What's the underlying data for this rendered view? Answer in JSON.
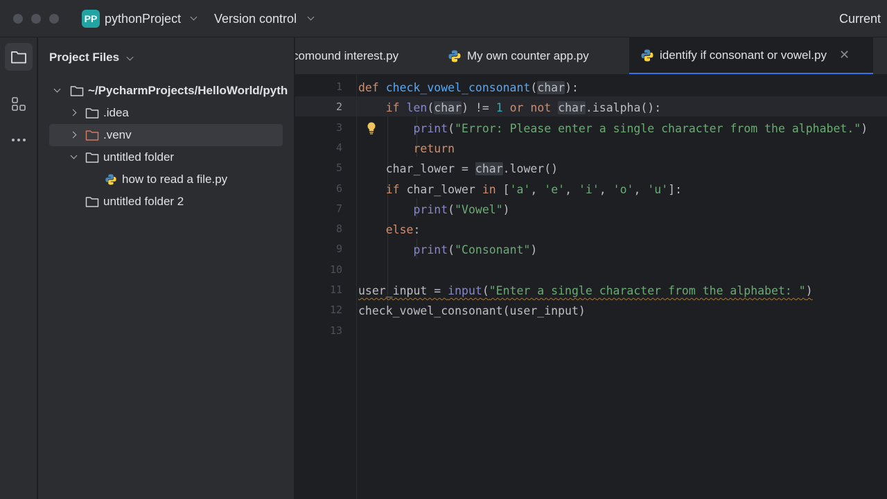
{
  "titlebar": {
    "project_badge": "PP",
    "project_name": "pythonProject",
    "vcs_label": "Version control",
    "run_config": "Current"
  },
  "toolstrip": {
    "icons": [
      "folder-icon",
      "structure-icon",
      "more-icon"
    ]
  },
  "project_panel": {
    "title": "Project Files",
    "tree": [
      {
        "label": "~/PycharmProjects/HelloWorld/pyth",
        "type": "folder",
        "expanded": true,
        "depth": 0
      },
      {
        "label": ".idea",
        "type": "folder",
        "expanded": false,
        "depth": 1
      },
      {
        "label": ".venv",
        "type": "folder-excluded",
        "expanded": false,
        "depth": 1,
        "selected": true
      },
      {
        "label": "untitled folder",
        "type": "folder",
        "expanded": true,
        "depth": 1
      },
      {
        "label": "how to read a file.py",
        "type": "python-file",
        "depth": 2
      },
      {
        "label": "untitled folder 2",
        "type": "folder",
        "depth": 1
      }
    ]
  },
  "tabs": [
    {
      "label": "comound interest.py",
      "active": false
    },
    {
      "label": "My own counter app.py",
      "active": false
    },
    {
      "label": "identify if consonant or vowel.py",
      "active": true
    }
  ],
  "editor": {
    "current_line": 2,
    "line_numbers": [
      "1",
      "2",
      "3",
      "4",
      "5",
      "6",
      "7",
      "8",
      "9",
      "10",
      "11",
      "12",
      "13"
    ],
    "lines": [
      {
        "indent": "",
        "tokens": [
          [
            "kw",
            "def "
          ],
          [
            "fn",
            "check_vowel_consonant"
          ],
          [
            "",
            "("
          ],
          [
            "hl",
            "char"
          ],
          [
            "",
            "):"
          ]
        ]
      },
      {
        "indent": "    ",
        "tokens": [
          [
            "kw",
            "if "
          ],
          [
            "bi",
            "len"
          ],
          [
            "",
            "("
          ],
          [
            "hl",
            "char"
          ],
          [
            "",
            ") != "
          ],
          [
            "num",
            "1"
          ],
          [
            "kw",
            " or not "
          ],
          [
            "hl",
            "char"
          ],
          [
            "",
            ".isalpha():"
          ]
        ]
      },
      {
        "indent": "        ",
        "tokens": [
          [
            "bi",
            "print"
          ],
          [
            "",
            "("
          ],
          [
            "str",
            "\"Error: Please enter a single character from the alphabet.\""
          ],
          [
            "",
            ")"
          ]
        ]
      },
      {
        "indent": "        ",
        "tokens": [
          [
            "kw",
            "return"
          ]
        ]
      },
      {
        "indent": "    ",
        "tokens": [
          [
            "",
            "char_lower = "
          ],
          [
            "hl",
            "char"
          ],
          [
            "",
            ".lower()"
          ]
        ]
      },
      {
        "indent": "    ",
        "tokens": [
          [
            "kw",
            "if "
          ],
          [
            "",
            "char_lower "
          ],
          [
            "kw",
            "in "
          ],
          [
            "",
            "["
          ],
          [
            "str",
            "'a'"
          ],
          [
            "",
            ", "
          ],
          [
            "str",
            "'e'"
          ],
          [
            "",
            ", "
          ],
          [
            "str",
            "'i'"
          ],
          [
            "",
            ", "
          ],
          [
            "str",
            "'o'"
          ],
          [
            "",
            ", "
          ],
          [
            "str",
            "'u'"
          ],
          [
            "",
            "]:"
          ]
        ]
      },
      {
        "indent": "        ",
        "tokens": [
          [
            "bi",
            "print"
          ],
          [
            "",
            "("
          ],
          [
            "str",
            "\"Vowel\""
          ],
          [
            "",
            ")"
          ]
        ]
      },
      {
        "indent": "    ",
        "tokens": [
          [
            "kw",
            "else"
          ],
          [
            "",
            ":"
          ]
        ]
      },
      {
        "indent": "        ",
        "tokens": [
          [
            "bi",
            "print"
          ],
          [
            "",
            "("
          ],
          [
            "str",
            "\"Consonant\""
          ],
          [
            "",
            ")"
          ]
        ]
      },
      {
        "indent": "",
        "tokens": []
      },
      {
        "indent": "",
        "squiggle": true,
        "tokens": [
          [
            "",
            "user_input = "
          ],
          [
            "bi",
            "input"
          ],
          [
            "",
            "("
          ],
          [
            "str",
            "\"Enter a single character from the alphabet: \""
          ],
          [
            "",
            ")"
          ]
        ]
      },
      {
        "indent": "",
        "tokens": [
          [
            "",
            "check_vowel_consonant(user_input)"
          ]
        ]
      },
      {
        "indent": "",
        "tokens": []
      }
    ]
  },
  "colors": {
    "accent": "#3574f0",
    "project_badge": "#21a4a4",
    "excluded_folder": "#d17a5c"
  }
}
